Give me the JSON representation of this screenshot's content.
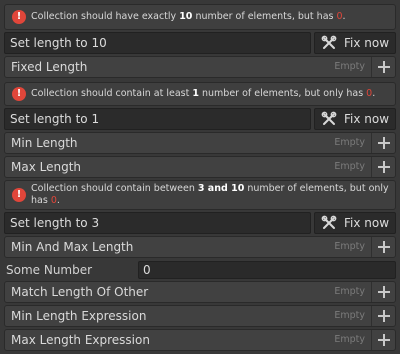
{
  "colors": {
    "error": "#e0463a",
    "background": "#383838"
  },
  "messages": {
    "exact": {
      "pre": "Collection should have exactly ",
      "n": "10",
      "mid": " number of elements, but has ",
      "zero": "0",
      "post": "."
    },
    "min": {
      "pre": "Collection should contain at least ",
      "n": "1",
      "mid": " number of elements, but only has ",
      "zero": "0",
      "post": "."
    },
    "between": {
      "pre": "Collection should contain between ",
      "n": "3 and 10",
      "mid": " number of elements, but only has ",
      "zero": "0",
      "post": "."
    }
  },
  "fix": {
    "set_exact": "Set length to 10",
    "set_min": "Set length to 1",
    "set_between": "Set length to 3",
    "button_label": "Fix now"
  },
  "lists": {
    "fixed_length": "Fixed Length",
    "min_length": "Min Length",
    "max_length": "Max Length",
    "min_and_max_length": "Min And Max Length",
    "match_length_of_other": "Match Length Of Other",
    "min_length_expression": "Min Length Expression",
    "max_length_expression": "Max Length Expression"
  },
  "empty_label": "Empty",
  "some_number": {
    "label": "Some Number",
    "value": "0"
  },
  "icons": {
    "error": "error-icon",
    "fix": "wrench-screwdriver-icon",
    "add": "plus-icon"
  }
}
